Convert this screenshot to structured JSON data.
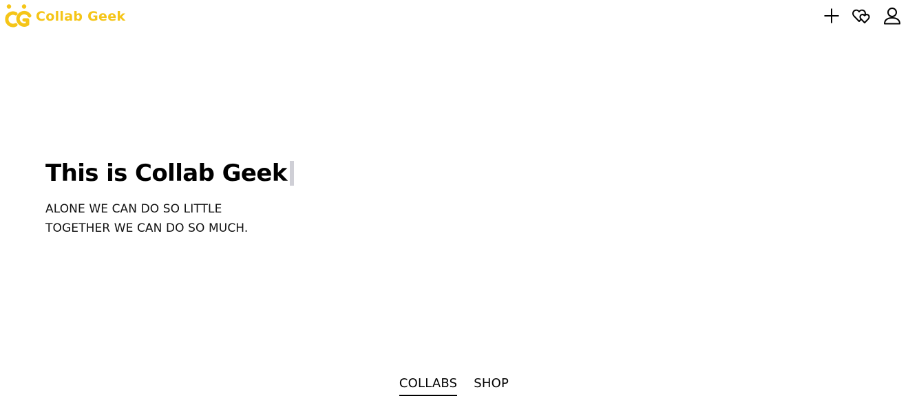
{
  "brand": {
    "name": "Collab Geek",
    "accent": "#f5c518"
  },
  "header": {
    "icons": [
      "plus-icon",
      "hearts-icon",
      "user-icon"
    ]
  },
  "hero": {
    "title": "This is Collab Geek",
    "subtitle_line1": "ALONE WE CAN DO SO LITTLE",
    "subtitle_line2": "TOGETHER WE CAN DO SO MUCH."
  },
  "tabs": [
    {
      "label": "COLLABS",
      "active": true
    },
    {
      "label": "SHOP",
      "active": false
    }
  ]
}
